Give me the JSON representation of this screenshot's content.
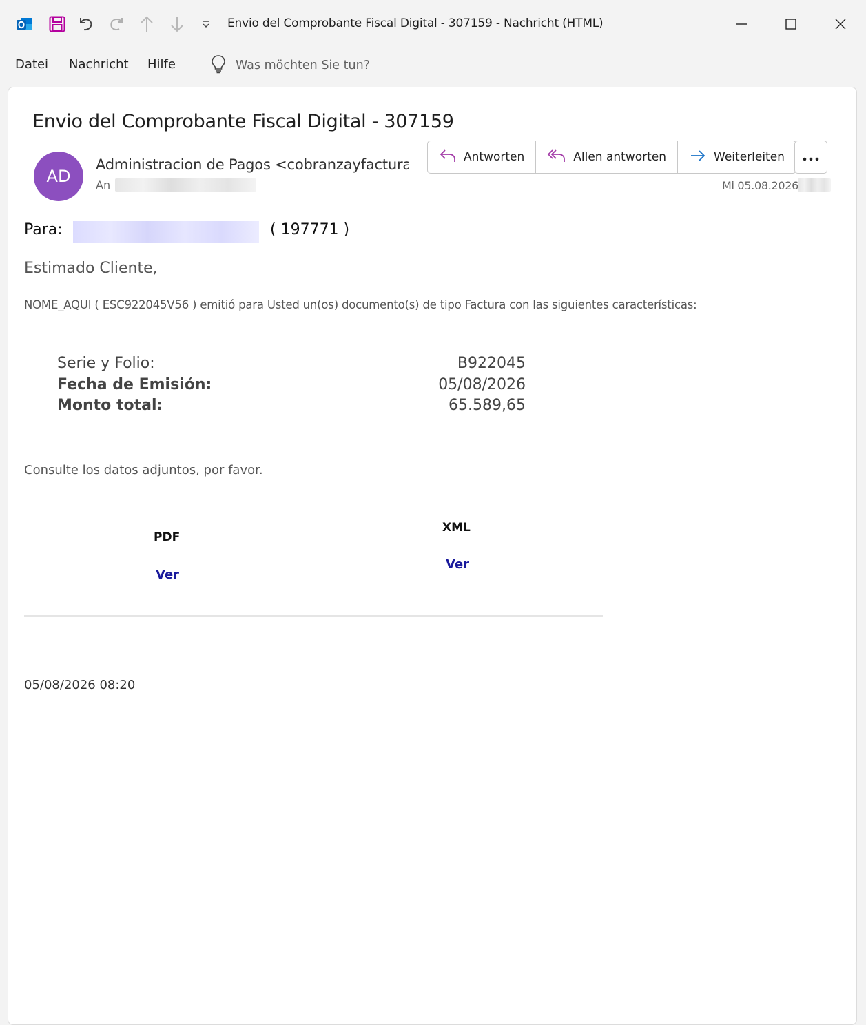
{
  "window": {
    "title": "Envio del Comprobante Fiscal Digital - 307159  -  Nachricht (HTML)"
  },
  "quick_access": {
    "icons": [
      "outlook-app-icon",
      "save-icon",
      "undo-icon",
      "redo-icon",
      "previous-item-icon",
      "next-item-icon",
      "customize-toolbar-icon"
    ]
  },
  "menu": {
    "items": [
      "Datei",
      "Nachricht",
      "Hilfe"
    ],
    "tell_me_placeholder": "Was möchten Sie tun?"
  },
  "message": {
    "subject": "Envio del Comprobante Fiscal Digital - 307159",
    "avatar_initials": "AD",
    "avatar_color": "#8c4fbf",
    "sender": "Administracion de Pagos <cobranzayfacturac",
    "to_label": "An",
    "date": "Mi 05.08.2026",
    "actions": {
      "reply": "Antworten",
      "reply_all": "Allen antworten",
      "forward": "Weiterleiten"
    }
  },
  "body": {
    "para_label": "Para:",
    "para_number": "( 197771 )",
    "greeting": "Estimado Cliente,",
    "intro": "NOME_AQUI  ( ESC922045V56 ) emitió para Usted un(os) documento(s) de tipo Factura con las siguientes características:",
    "details": [
      {
        "label": "Serie y Folio:",
        "value": "B922045"
      },
      {
        "label": "Fecha de Emisión:",
        "value": "05/08/2026"
      },
      {
        "label": "Monto total:",
        "value": "65.589,65"
      }
    ],
    "consulte": "Consulte los datos adjuntos, por favor.",
    "pdf_label": "PDF",
    "pdf_link": "Ver",
    "xml_label": "XML",
    "xml_link": "Ver",
    "timestamp": "05/08/2026 08:20",
    "link_color": "#1a1a9c"
  }
}
